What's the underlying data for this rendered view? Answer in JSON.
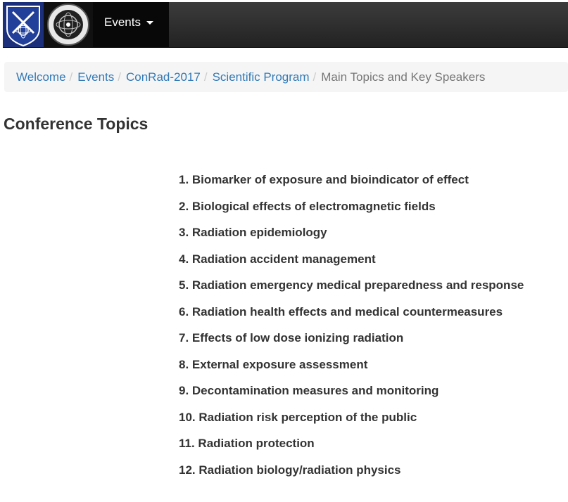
{
  "navbar": {
    "menu_label": "Events",
    "icons": {
      "logo_left": "military-academy-emblem-icon",
      "logo_right": "institute-seal-icon",
      "dropdown": "caret-down-icon"
    },
    "colors": {
      "background": "#222222",
      "active_item": "#080808",
      "logo_left_bg": "#1b2f7a",
      "text": "#ffffff"
    }
  },
  "breadcrumb": {
    "items": [
      "Welcome",
      "Events",
      "ConRad-2017",
      "Scientific Program"
    ],
    "current": "Main Topics and Key Speakers",
    "separator": "/",
    "colors": {
      "link": "#337ab7",
      "active": "#777777",
      "background": "#f5f5f5"
    }
  },
  "page": {
    "title": "Conference Topics",
    "topics": [
      "1. Biomarker of exposure and bioindicator of effect",
      "2. Biological effects of electromagnetic fields",
      "3. Radiation epidemiology",
      "4. Radiation accident management",
      "5. Radiation emergency medical preparedness and response",
      "6. Radiation health effects and medical countermeasures",
      "7. Effects of low dose ionizing radiation",
      "8. External exposure assessment",
      "9. Decontamination measures and monitoring",
      "10. Radiation risk perception of the public",
      "11. Radiation protection",
      "12. Radiation biology/radiation physics"
    ]
  }
}
